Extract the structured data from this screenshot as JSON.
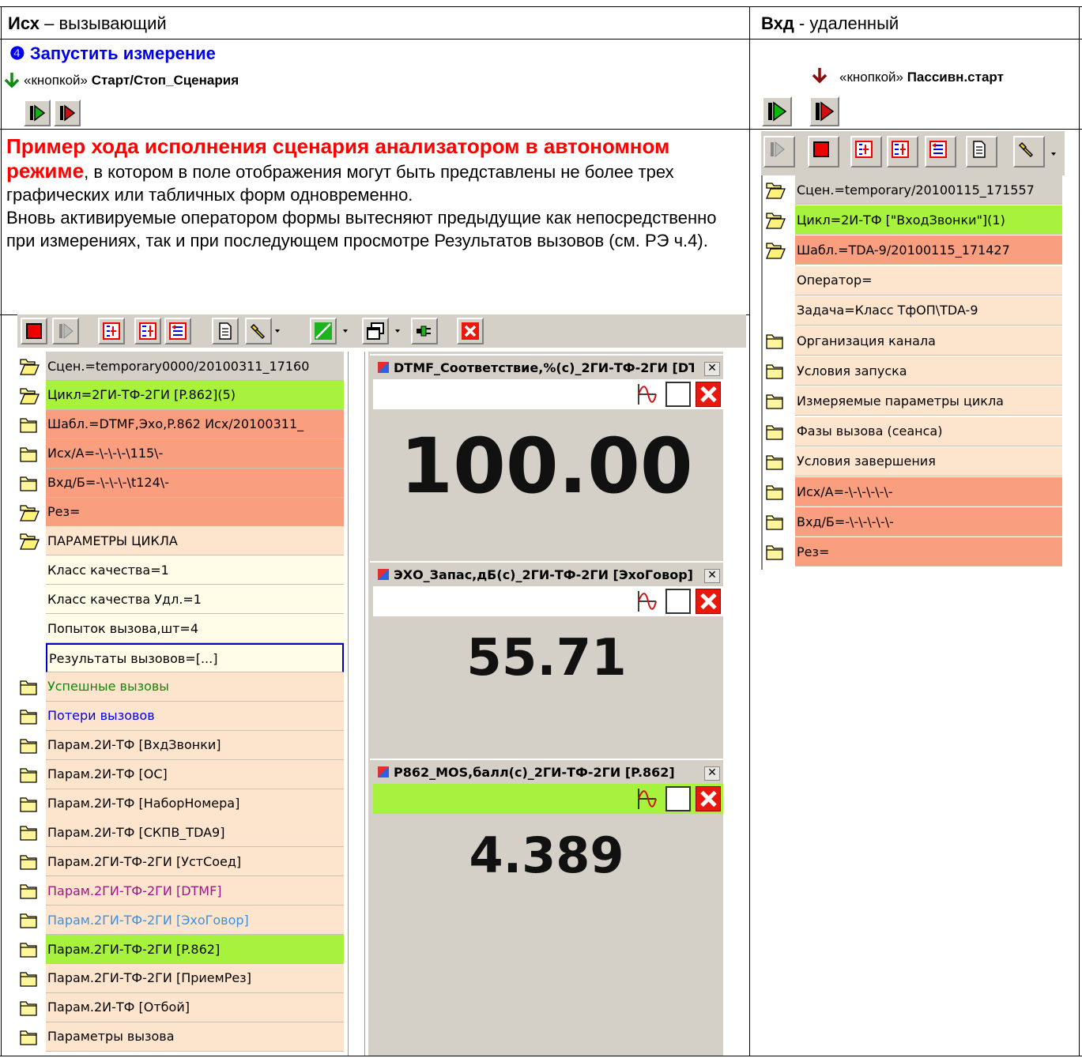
{
  "header": {
    "left_bold": "Исх",
    "left_rest": " – вызывающий",
    "right_bold": "Вхд",
    "right_rest": " - удаленный"
  },
  "step": {
    "title": "❹ Запустить измерение",
    "left_hint_prefix": "«кнопкой» ",
    "left_hint_bold": "Старт/Стоп_Сценария",
    "right_hint_prefix": "«кнопкой» ",
    "right_hint_bold": "Пассивн.старт"
  },
  "description": {
    "title_red": "Пример хода исполнения сценария анализатором в автономном режиме",
    "text1": ", в котором в поле отображения могут быть представлены не более трех графических или табличных форм одновременно.",
    "text2": "Вновь активируемые оператором формы вытесняют предыдущие как непосредственно при измерениях, так и при последующем просмотре Результатов вызовов (см. РЭ ч.4)."
  },
  "left_tree": [
    {
      "label": "Сцен.=temporary0000/20100311_17160",
      "bg": "#d4d0c8",
      "icon": "open",
      "color": "#000"
    },
    {
      "label": "Цикл=2ГИ-ТФ-2ГИ [P.862](5)",
      "bg": "#a6f23c",
      "icon": "open",
      "color": "#000"
    },
    {
      "label": "Шабл.=DTMF,Эхо,P.862  Исх/20100311_",
      "bg": "#f99f80",
      "icon": "closed",
      "color": "#000"
    },
    {
      "label": "Исх/А=-\\-\\-\\-\\115\\-",
      "bg": "#f99f80",
      "icon": "closed",
      "color": "#000"
    },
    {
      "label": "Вхд/Б=-\\-\\-\\-\\t124\\-",
      "bg": "#f99f80",
      "icon": "closed",
      "color": "#000"
    },
    {
      "label": "Рез=",
      "bg": "#f99f80",
      "icon": "open",
      "color": "#000"
    },
    {
      "label": "ПАРАМЕТРЫ ЦИКЛА",
      "bg": "#fde5cd",
      "icon": "open",
      "color": "#000"
    },
    {
      "label": "Класс качества=1",
      "bg": "#fffde8",
      "icon": "none",
      "color": "#000"
    },
    {
      "label": "Класс качества Удл.=1",
      "bg": "#fffde8",
      "icon": "none",
      "color": "#000"
    },
    {
      "label": "Попыток вызова,шт=4",
      "bg": "#fffde8",
      "icon": "none",
      "color": "#000"
    },
    {
      "label": "Результаты вызовов=[...]",
      "bg": "#fffde8",
      "icon": "none",
      "color": "#000",
      "selected": true
    },
    {
      "label": "Успешные вызовы",
      "bg": "#fde5cd",
      "icon": "closed",
      "color": "#0a8a0a"
    },
    {
      "label": "Потери вызовов",
      "bg": "#fde5cd",
      "icon": "closed",
      "color": "#0000ee"
    },
    {
      "label": "Парам.2И-ТФ [ВхдЗвонки]",
      "bg": "#fde5cd",
      "icon": "closed",
      "color": "#000"
    },
    {
      "label": "Парам.2И-ТФ [ОС]",
      "bg": "#fde5cd",
      "icon": "closed",
      "color": "#000"
    },
    {
      "label": "Парам.2И-ТФ [НаборНомера]",
      "bg": "#fde5cd",
      "icon": "closed",
      "color": "#000"
    },
    {
      "label": "Парам.2И-ТФ [СКПВ_TDA9]",
      "bg": "#fde5cd",
      "icon": "closed",
      "color": "#000"
    },
    {
      "label": "Парам.2ГИ-ТФ-2ГИ [УстСоед]",
      "bg": "#fde5cd",
      "icon": "closed",
      "color": "#000"
    },
    {
      "label": "Парам.2ГИ-ТФ-2ГИ [DTMF]",
      "bg": "#fde5cd",
      "icon": "closed",
      "color": "#a0138c"
    },
    {
      "label": "Парам.2ГИ-ТФ-2ГИ [ЭхоГовор]",
      "bg": "#fde5cd",
      "icon": "closed",
      "color": "#3d8fe0"
    },
    {
      "label": "Парам.2ГИ-ТФ-2ГИ [P.862]",
      "bg": "#a6f23c",
      "icon": "closed",
      "color": "#000"
    },
    {
      "label": "Парам.2ГИ-ТФ-2ГИ [ПриемРез]",
      "bg": "#fde5cd",
      "icon": "closed",
      "color": "#000"
    },
    {
      "label": "Парам.2И-ТФ [Отбой]",
      "bg": "#fde5cd",
      "icon": "closed",
      "color": "#000"
    },
    {
      "label": "Параметры вызова",
      "bg": "#fde5cd",
      "icon": "closed",
      "color": "#000"
    }
  ],
  "right_tree": [
    {
      "label": "Сцен.=temporary/20100115_171557",
      "bg": "#d4d0c8",
      "icon": "open"
    },
    {
      "label": "Цикл=2И-ТФ  [\"ВходЗвонки\"](1)",
      "bg": "#a6f23c",
      "icon": "open"
    },
    {
      "label": "Шабл.=TDA-9/20100115_171427",
      "bg": "#f99f80",
      "icon": "open"
    },
    {
      "label": "Оператор=",
      "bg": "#fde5cd",
      "icon": "none"
    },
    {
      "label": "Задача=Класс ТфОП\\TDA-9",
      "bg": "#fde5cd",
      "icon": "none"
    },
    {
      "label": "Организация канала",
      "bg": "#fde5cd",
      "icon": "closed"
    },
    {
      "label": "Условия запуска",
      "bg": "#fde5cd",
      "icon": "closed"
    },
    {
      "label": "Измеряемые параметры цикла",
      "bg": "#fde5cd",
      "icon": "closed"
    },
    {
      "label": "Фазы вызова (сеанса)",
      "bg": "#fde5cd",
      "icon": "closed"
    },
    {
      "label": "Условия завершения",
      "bg": "#fde5cd",
      "icon": "closed"
    },
    {
      "label": "Исх/А=-\\-\\-\\-\\-\\-",
      "bg": "#f99f80",
      "icon": "closed"
    },
    {
      "label": "Вхд/Б=-\\-\\-\\-\\-\\-",
      "bg": "#f99f80",
      "icon": "closed"
    },
    {
      "label": "Рез=",
      "bg": "#f99f80",
      "icon": "closed"
    }
  ],
  "windows": [
    {
      "title": "DTMF_Соответствие,%(с)_2ГИ-ТФ-2ГИ [DT...",
      "value": "100.00",
      "bar_bg": "#ffffff",
      "close": "x"
    },
    {
      "title": "ЭХО_Запас,дБ(с)_2ГИ-ТФ-2ГИ [ЭхоГовор]",
      "value": "55.71",
      "bar_bg": "#ffffff",
      "close": "x"
    },
    {
      "title": "P862_MOS,балл(с)_2ГИ-ТФ-2ГИ [P.862]",
      "value": "4.389",
      "bar_bg": "#a6f23c",
      "close": "x"
    }
  ]
}
